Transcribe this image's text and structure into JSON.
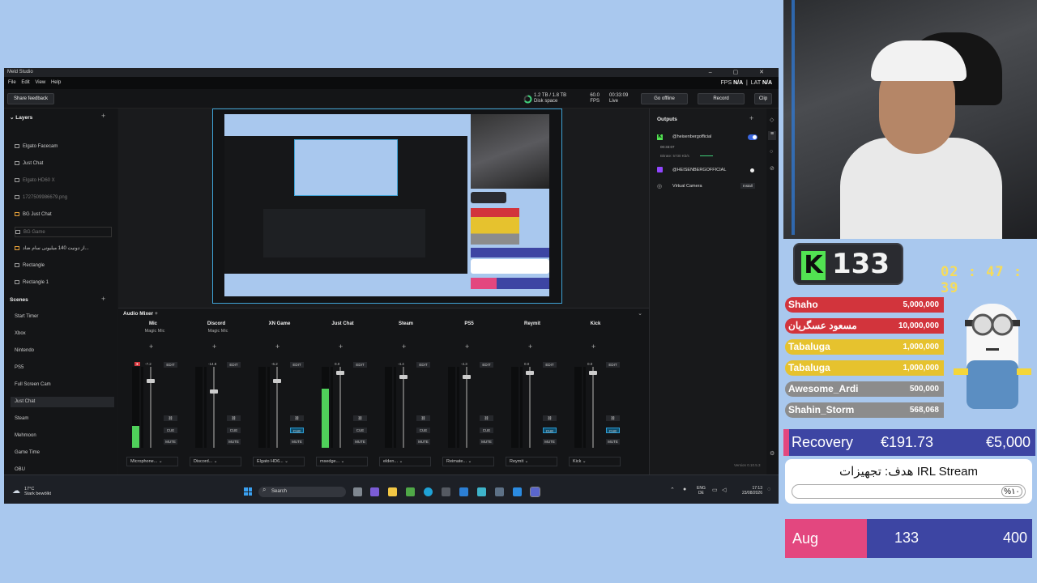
{
  "app": {
    "title": "Meld Studio",
    "window_controls": "–  ▢  ✕",
    "menu": [
      "File",
      "Edit",
      "View",
      "Help"
    ],
    "fps_label": "FPS",
    "fps_value": "N/A",
    "lat_label": "LAT",
    "lat_value": "N/A"
  },
  "toolbar": {
    "share_feedback": "Share feedback",
    "disk_value": "1.2 TB / 1.8 TB",
    "disk_label": "Disk space",
    "fps_value": "60.0",
    "fps_label": "FPS",
    "time_value": "00:33:09",
    "time_label": "Live",
    "go_offline": "Go offline",
    "record": "Record",
    "clip": "Clip"
  },
  "layers": {
    "title": "Layers",
    "items": [
      {
        "label": "Elgato Facecam",
        "dim": false
      },
      {
        "label": "Just Chat",
        "dim": false
      },
      {
        "label": "Elgato HD60 X",
        "dim": true
      },
      {
        "label": "1727509986679.png",
        "dim": true
      },
      {
        "label": "BG Just Chat",
        "dim": false
      },
      {
        "label": "BG Game",
        "dim": true
      },
      {
        "label": "از دونیت 140 میلیونی سام ضاد...",
        "dim": false
      },
      {
        "label": "Rectangle",
        "dim": false
      },
      {
        "label": "Rectangle 1",
        "dim": false
      }
    ]
  },
  "scenes": {
    "title": "Scenes",
    "items": [
      "Start Timer",
      "Xbox",
      "Nintendo",
      "PS5",
      "Full Screen Cam",
      "Just Chat",
      "Steam",
      "Mehmoon",
      "Game Time",
      "OBU"
    ]
  },
  "mixer": {
    "title": "Audio Mixer",
    "edit_label": "EDIT",
    "cue_label": "CUE",
    "mute_label": "MUTE",
    "channels": [
      {
        "name": "Mic",
        "sub": "Magic Mic",
        "db": "-7.2",
        "level": 0.27,
        "fader": 0.85,
        "source": "Microphone...",
        "cue_on": false,
        "peak": true
      },
      {
        "name": "Discord",
        "sub": "Magic Mic",
        "db": "-14.8",
        "level": 0,
        "fader": 0.72,
        "source": "Discord...",
        "cue_on": false,
        "peak": false
      },
      {
        "name": "XN Game",
        "sub": "",
        "db": "-6.2",
        "level": 0,
        "fader": 0.85,
        "source": "Elgato HD6...",
        "cue_on": true,
        "peak": false
      },
      {
        "name": "Just Chat",
        "sub": "",
        "db": "0.0",
        "level": 0.73,
        "fader": 0.95,
        "source": "msedge...",
        "cue_on": false,
        "peak": false
      },
      {
        "name": "Steam",
        "sub": "",
        "db": "-4.4",
        "level": 0,
        "fader": 0.9,
        "source": "elden...",
        "cue_on": false,
        "peak": false
      },
      {
        "name": "PS5",
        "sub": "",
        "db": "-4.3",
        "level": 0,
        "fader": 0.9,
        "source": "Reimate...",
        "cue_on": false,
        "peak": false
      },
      {
        "name": "Reymit",
        "sub": "",
        "db": "0.0",
        "level": 0,
        "fader": 0.95,
        "source": "Reymit",
        "cue_on": true,
        "peak": false
      },
      {
        "name": "Kick",
        "sub": "",
        "db": "0.0",
        "level": 0,
        "fader": 0.95,
        "source": "Kick",
        "cue_on": true,
        "peak": false
      }
    ]
  },
  "outputs": {
    "title": "Outputs",
    "items": [
      {
        "name": "@heisenbergofficial",
        "time": "00:33:07",
        "bitrate": "Bitrate: 5730 Kb/s"
      },
      {
        "name": "@HEISENBERGOFFICIAL"
      },
      {
        "name": "Virtual Camera",
        "action": "Install"
      }
    ],
    "version": "Version 0.10.5.3"
  },
  "taskbar": {
    "weather_temp": "17°C",
    "weather_desc": "Stark bewölkt",
    "search": "Search",
    "lang_top": "ENG",
    "lang_bottom": "DE",
    "time": "17:13",
    "date": "23/08/2026"
  },
  "overlay": {
    "kick_count": "133",
    "timer": "02 : 47 : 39",
    "leaderboard": [
      {
        "name": "Shaho",
        "value": "5,000,000",
        "color": "#d2343c"
      },
      {
        "name": "مسعود عسگریان",
        "value": "10,000,000",
        "color": "#d2343c"
      },
      {
        "name": "Tabaluga",
        "value": "1,000,000",
        "color": "#e6c22e"
      },
      {
        "name": "Tabaluga",
        "value": "1,000,000",
        "color": "#e6c22e"
      },
      {
        "name": "Awesome_Ardi",
        "value": "500,000",
        "color": "#8c8c8c"
      },
      {
        "name": "Shahin_Storm",
        "value": "568,068",
        "color": "#8c8c8c"
      }
    ],
    "recovery_label": "Recovery",
    "recovery_current": "€191.73",
    "recovery_goal": "€5,000",
    "goal_title": "هدف: تجهیزات IRL Stream",
    "goal_percent": "%۱۰",
    "sub_month": "Aug",
    "sub_count": "133",
    "sub_goal": "400"
  }
}
